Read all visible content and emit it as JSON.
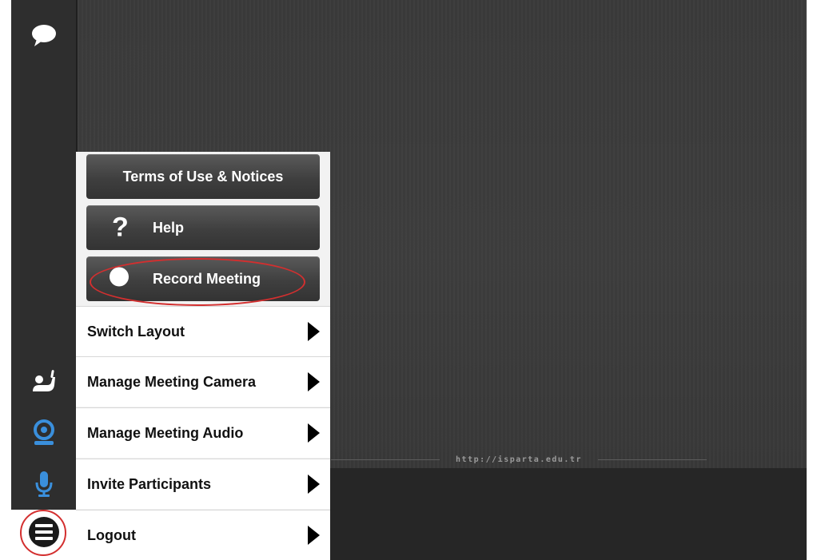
{
  "stage": {
    "watermark_url": "http://isparta.edu.tr"
  },
  "sidebar": {
    "items": [
      {
        "icon": "chat-bubble-icon"
      },
      {
        "icon": "raise-hand-icon"
      },
      {
        "icon": "webcam-icon",
        "color": "#3a8fdc"
      },
      {
        "icon": "microphone-icon",
        "color": "#3a8fdc"
      },
      {
        "icon": "hamburger-menu-icon"
      }
    ]
  },
  "menu": {
    "buttons": [
      {
        "label": "Terms of Use & Notices"
      },
      {
        "label": "Help",
        "icon_glyph": "?"
      },
      {
        "label": "Record Meeting",
        "icon": "record-toggle-icon"
      }
    ],
    "items": [
      {
        "label": "Switch Layout"
      },
      {
        "label": "Manage Meeting Camera"
      },
      {
        "label": "Manage Meeting Audio"
      },
      {
        "label": "Invite Participants"
      },
      {
        "label": "Logout"
      }
    ]
  },
  "colors": {
    "highlight": "#d32f2f",
    "accent": "#3a8fdc",
    "panel_dark": "#3b3b3b"
  }
}
